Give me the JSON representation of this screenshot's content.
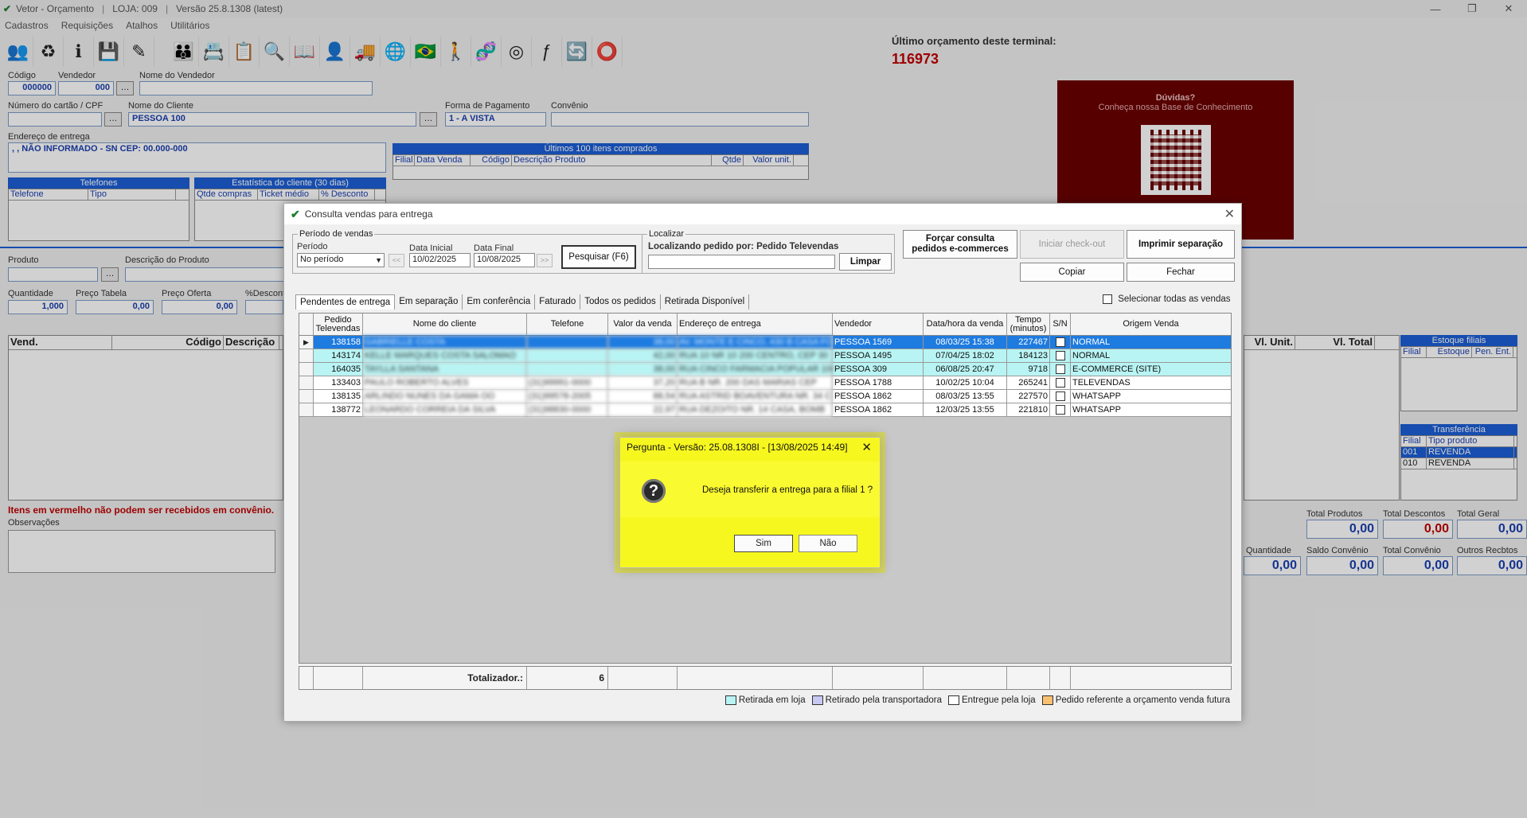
{
  "app": {
    "title": "Vetor - Orçamento",
    "loja": "LOJA: 009",
    "versao": "Versão 25.8.1308 (latest)",
    "menu": [
      "Cadastros",
      "Requisições",
      "Atalhos",
      "Utilitários"
    ],
    "window_controls": [
      "—",
      "❐",
      "✕"
    ]
  },
  "background": {
    "last_budget_label": "Último orçamento deste terminal:",
    "last_budget_value": "116973",
    "codigo_label": "Código",
    "codigo_value": "000000",
    "vendedor_label": "Vendedor",
    "vendedor_value": "000",
    "nome_vendedor_label": "Nome do Vendedor",
    "cartao_label": "Número do cartão / CPF",
    "nome_cliente_label": "Nome do Cliente",
    "nome_cliente_value": "PESSOA 100",
    "forma_pagamento_label": "Forma de Pagamento",
    "forma_pagamento_value": "1 - A VISTA",
    "convenio_label": "Convênio",
    "endereco_label": "Endereço de entrega",
    "endereco_value": ", , NÃO INFORMADO - SN CEP: 00.000-000",
    "ultimos_itens": "Últimos 100 itens comprados",
    "ultimos_cols": [
      "Filial",
      "Data Venda",
      "Código",
      "Descrição Produto",
      "Qtde",
      "Valor unit."
    ],
    "telefones": "Telefones",
    "telefones_cols": [
      "Telefone",
      "Tipo"
    ],
    "estatistica": "Estatística do cliente (30 dias)",
    "estatistica_cols": [
      "Qtde compras",
      "Ticket médio",
      "% Desconto"
    ],
    "produto_label": "Produto",
    "descricao_label": "Descrição do Produto",
    "quantidade_label": "Quantidade",
    "quantidade_value": "1,000",
    "preco_tabela_label": "Preço Tabela",
    "preco_tabela_value": "0,00",
    "preco_oferta_label": "Preço Oferta",
    "preco_oferta_value": "0,00",
    "pct_desconto_label": "%Desconto",
    "grid_cols": [
      "Vend.",
      "Código",
      "Descrição"
    ],
    "grid_cols_right": [
      "Vl. Unit.",
      "Vl. Total"
    ],
    "aviso": "Itens em vermelho não podem ser recebidos em convênio.",
    "observacoes_label": "Observações",
    "estoque_filiais": "Estoque filiais",
    "estoque_cols": [
      "Filial",
      "Estoque",
      "Pen. Ent."
    ],
    "transferencia": "Transferência",
    "transferencia_cols": [
      "Filial",
      "Tipo produto"
    ],
    "transferencia_rows": [
      {
        "filial": "001",
        "tipo": "REVENDA"
      },
      {
        "filial": "010",
        "tipo": "REVENDA"
      }
    ],
    "totals": {
      "total_produtos_label": "Total Produtos",
      "total_produtos": "0,00",
      "total_descontos_label": "Total Descontos",
      "total_descontos": "0,00",
      "total_geral_label": "Total Geral",
      "total_geral": "0,00",
      "quantidade_label": "Quantidade",
      "quantidade": "0,00",
      "saldo_convenio_label": "Saldo Convênio",
      "saldo_convenio": "0,00",
      "total_convenio_label": "Total Convênio",
      "total_convenio": "0,00",
      "outros_label": "Outros Recbtos",
      "outros": "0,00"
    },
    "promo": {
      "title": "Dúvidas?",
      "subtitle": "Conheça nossa Base de Conhecimento"
    }
  },
  "dialog": {
    "title": "Consulta vendas para entrega",
    "periodo_group": "Período de vendas",
    "periodo_label": "Período",
    "periodo_value": "No período",
    "data_inicial_label": "Data Inicial",
    "data_inicial": "10/02/2025",
    "data_final_label": "Data Final",
    "data_final": "10/08/2025",
    "prev": "<<",
    "next": ">>",
    "pesquisar": "Pesquisar (F6)",
    "localizar_group": "Localizar",
    "localizando": "Localizando pedido por: Pedido Televendas",
    "limpar": "Limpar",
    "forcar_line1": "Forçar consulta",
    "forcar_line2": "pedidos e-commerces",
    "iniciar_checkout": "Iniciar check-out",
    "imprimir": "Imprimir separação",
    "copiar": "Copiar",
    "fechar": "Fechar",
    "selecionar_todas": "Selecionar todas as vendas",
    "tabs": [
      "Pendentes de entrega",
      "Em separação",
      "Em conferência",
      "Faturado",
      "Todos os pedidos",
      "Retirada Disponível"
    ],
    "columns": {
      "pedido": "Pedido Televendas",
      "cliente": "Nome do cliente",
      "telefone": "Telefone",
      "valor": "Valor da venda",
      "endereco": "Endereço de entrega",
      "vendedor": "Vendedor",
      "data": "Data/hora da venda",
      "tempo": "Tempo (minutos)",
      "sn": "S/N",
      "origem": "Origem Venda"
    },
    "rows": [
      {
        "pedido": "138158",
        "cliente": "GABRIELLE COSTA",
        "telefone": "",
        "valor": "38,00",
        "endereco": "AV. MONTE E CINCO, 430 B CASA FON",
        "vendedor": "PESSOA 1569",
        "data": "08/03/25 15:38",
        "tempo": "227467",
        "origem": "NORMAL",
        "style": "sel"
      },
      {
        "pedido": "143174",
        "cliente": "KELLE MARQUES COSTA SALOMAO",
        "telefone": "",
        "valor": "42,00",
        "endereco": "RUA 10 NR 10 200 CENTRO, CEP 30",
        "vendedor": "PESSOA 1495",
        "data": "07/04/25 18:02",
        "tempo": "184123",
        "origem": "NORMAL",
        "style": "cyan"
      },
      {
        "pedido": "164035",
        "cliente": "TAYLLA SANTANA",
        "telefone": "",
        "valor": "38,00",
        "endereco": "RUA CINCO FARMACIA POPULAR 100",
        "vendedor": "PESSOA 309",
        "data": "06/08/25 20:47",
        "tempo": "9718",
        "origem": "E-COMMERCE (SITE)",
        "style": "cyan"
      },
      {
        "pedido": "133403",
        "cliente": "PAULO ROBERTO ALVES",
        "telefone": "(31)99991-0000",
        "valor": "37,20",
        "endereco": "RUA B NR. 200 DAS MARIAS CEP",
        "vendedor": "PESSOA 1788",
        "data": "10/02/25 10:04",
        "tempo": "265241",
        "origem": "TELEVENDAS",
        "style": "white"
      },
      {
        "pedido": "138135",
        "cliente": "ARLINDO NUNES DA GAMA OO",
        "telefone": "(31)99578-2005",
        "valor": "88,54",
        "endereco": "RUA ASTRID BOAVENTURA NR. 34 C",
        "vendedor": "PESSOA 1862",
        "data": "08/03/25 13:55",
        "tempo": "227570",
        "origem": "WHATSAPP",
        "style": "white"
      },
      {
        "pedido": "138772",
        "cliente": "LEONARDO CORREIA DA SILVA",
        "telefone": "(31)98830-0000",
        "valor": "22,97",
        "endereco": "RUA DEZOITO NR. 14 CASA, BOMB",
        "vendedor": "PESSOA 1862",
        "data": "12/03/25 13:55",
        "tempo": "221810",
        "origem": "WHATSAPP",
        "style": "white"
      }
    ],
    "totalizador_label": "Totalizador.:",
    "totalizador_value": "6",
    "legend": [
      {
        "label": "Retirada em loja",
        "color": "#b9f4f4"
      },
      {
        "label": "Retirado pela transportadora",
        "color": "#c8c8f4"
      },
      {
        "label": "Entregue pela loja",
        "color": "#ffffff"
      },
      {
        "label": "Pedido referente a orçamento venda futura",
        "color": "#f8c070"
      }
    ]
  },
  "question": {
    "title": "Pergunta - Versão: 25.08.1308I - [13/08/2025 14:49]",
    "text": "Deseja transferir a entrega para a filial 1 ?",
    "icon": "?",
    "yes": "Sim",
    "no": "Não"
  }
}
